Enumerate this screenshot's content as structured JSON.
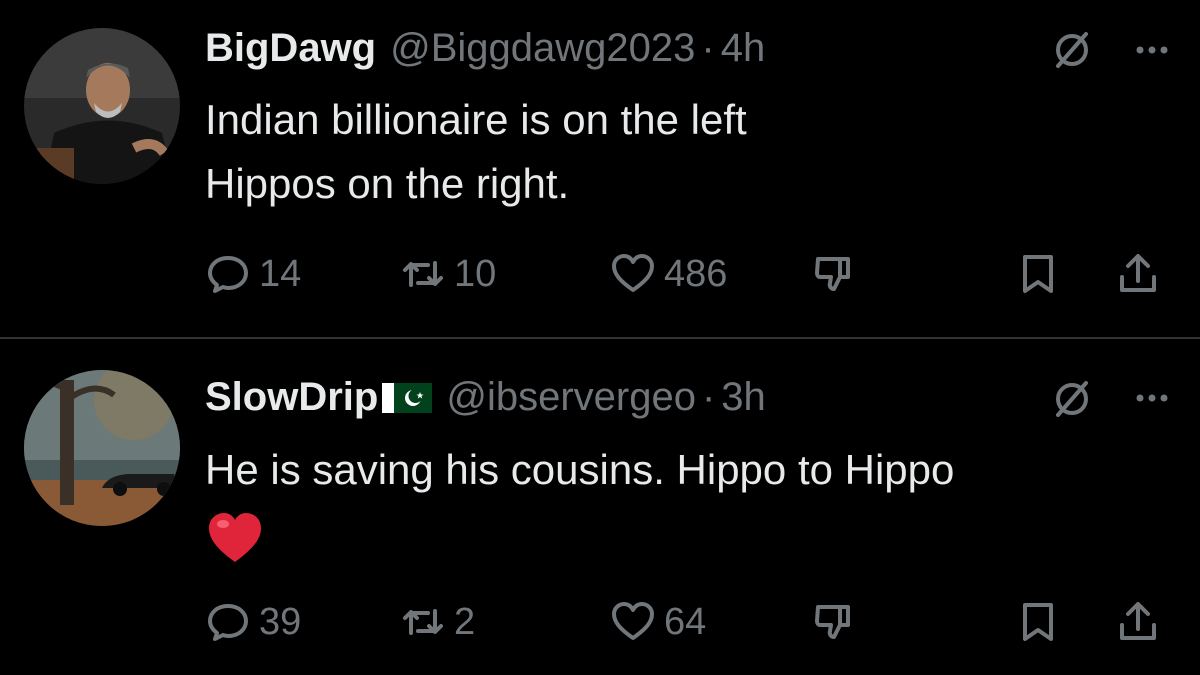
{
  "tweets": [
    {
      "name": "BigDawg",
      "handle": "@Biggdawg2023",
      "separator": "·",
      "time": "4h",
      "text_lines": [
        "Indian billionaire is on the left",
        "Hippos on the right."
      ],
      "replies": "14",
      "retweets": "10",
      "likes": "486",
      "avatar": "man-speaking-portrait"
    },
    {
      "name": "SlowDrip",
      "flag": "pakistan-flag",
      "handle": "@ibservergeo",
      "separator": "·",
      "time": "3h",
      "text_lines": [
        "He is saving his cousins. Hippo to Hippo"
      ],
      "emoji": "red-heart",
      "replies": "39",
      "retweets": "2",
      "likes": "64",
      "avatar": "autumn-park-car"
    }
  ],
  "colors": {
    "background": "#000000",
    "text": "#e7e9ea",
    "secondary": "#71767b",
    "divider": "#2f3336"
  },
  "icons": [
    "reply-icon",
    "retweet-icon",
    "like-icon",
    "dislike-icon",
    "bookmark-icon",
    "share-icon",
    "hide-icon",
    "more-icon"
  ]
}
